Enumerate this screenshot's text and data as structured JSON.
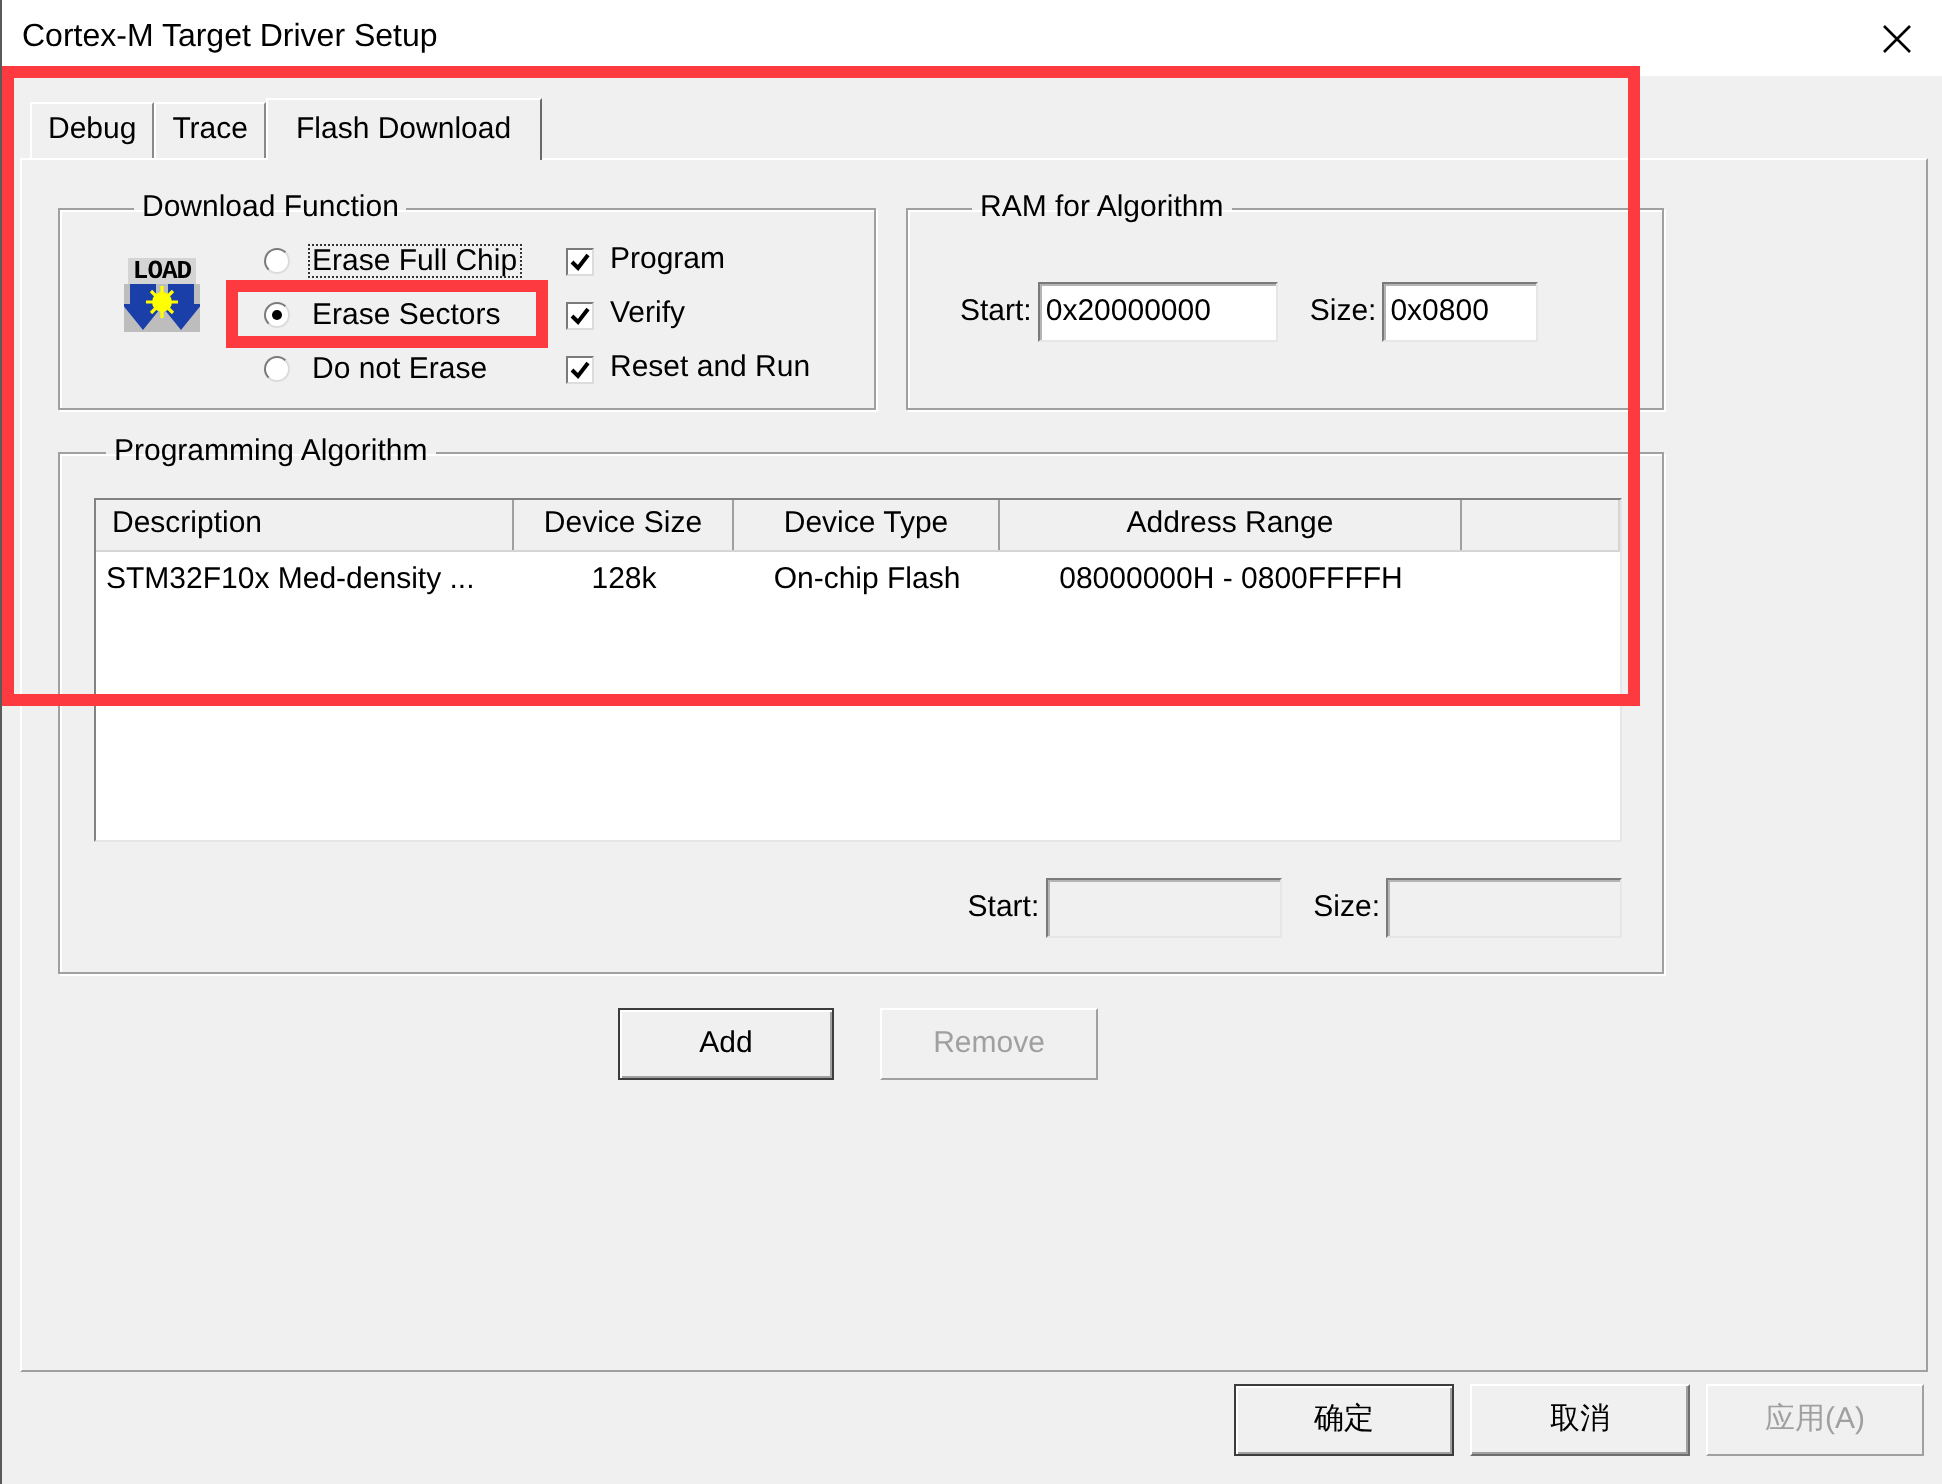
{
  "window": {
    "title": "Cortex-M Target Driver Setup"
  },
  "highlight_region": true,
  "tabs": [
    {
      "label": "Debug",
      "selected": false
    },
    {
      "label": "Trace",
      "selected": false
    },
    {
      "label": "Flash Download",
      "selected": true
    }
  ],
  "download_function": {
    "title": "Download Function",
    "icon_label": "LOAD",
    "erase_options": [
      {
        "label": "Erase Full Chip",
        "selected": false,
        "focused": true,
        "highlighted": false
      },
      {
        "label": "Erase Sectors",
        "selected": true,
        "focused": false,
        "highlighted": true
      },
      {
        "label": "Do not Erase",
        "selected": false,
        "focused": false,
        "highlighted": false
      }
    ],
    "actions": [
      {
        "label": "Program",
        "checked": true
      },
      {
        "label": "Verify",
        "checked": true
      },
      {
        "label": "Reset and Run",
        "checked": true
      }
    ]
  },
  "ram_for_algorithm": {
    "title": "RAM for Algorithm",
    "start": {
      "label": "Start:",
      "value": "0x20000000",
      "disabled": false
    },
    "size": {
      "label": "Size:",
      "value": "0x0800",
      "disabled": false
    }
  },
  "programming_algorithm": {
    "title": "Programming Algorithm",
    "table": {
      "columns": [
        "Description",
        "Device Size",
        "Device Type",
        "Address Range"
      ],
      "rows": [
        [
          "STM32F10x Med-density ...",
          "128k",
          "On-chip Flash",
          "08000000H - 0800FFFFH"
        ]
      ]
    },
    "start": {
      "label": "Start:",
      "disabled": true
    },
    "size": {
      "label": "Size:",
      "disabled": true
    }
  },
  "algorithm_buttons": [
    {
      "label": "Add",
      "disabled": false,
      "default": true
    },
    {
      "label": "Remove",
      "disabled": true,
      "default": false
    }
  ],
  "dialog_buttons": [
    {
      "label": "确定",
      "disabled": false,
      "default": true
    },
    {
      "label": "取消",
      "disabled": false,
      "default": false
    },
    {
      "label": "应用(A)",
      "disabled": true,
      "default": false
    }
  ]
}
